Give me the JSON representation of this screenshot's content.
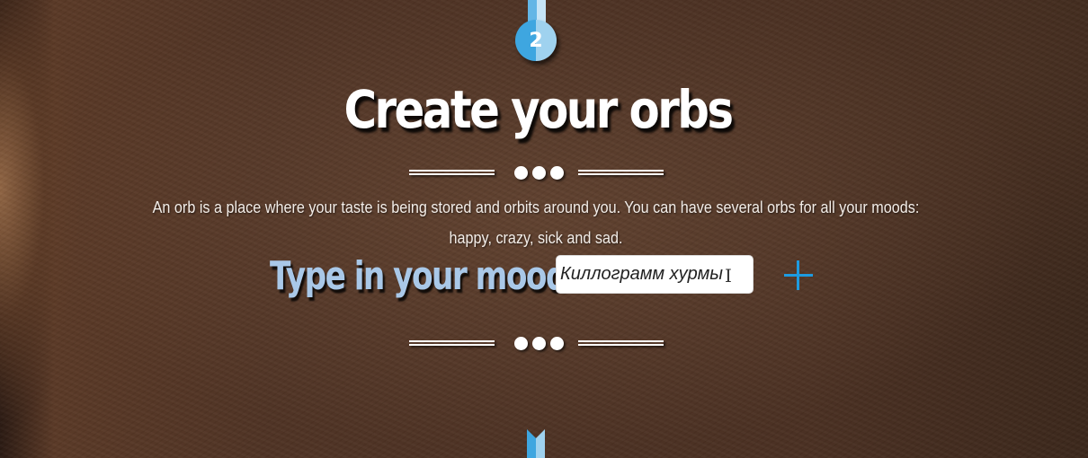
{
  "step": {
    "number": "2"
  },
  "section": {
    "title": "Create your orbs",
    "description": "An orb is a place where your taste is being stored and orbits around you. You can have several orbs for all your moods: happy, crazy, sick and sad."
  },
  "mood": {
    "label": "Type in your mood",
    "input_value": "Киллограмм хурмы",
    "add_icon": "plus-icon"
  },
  "icons": {
    "cursor": "text-cursor-icon",
    "next": "chevron-down-icon"
  },
  "colors": {
    "accent": "#1e9be0",
    "mood_label": "#a9c8e8",
    "step_circle": "#3ea6e0",
    "title": "#ffffff"
  }
}
